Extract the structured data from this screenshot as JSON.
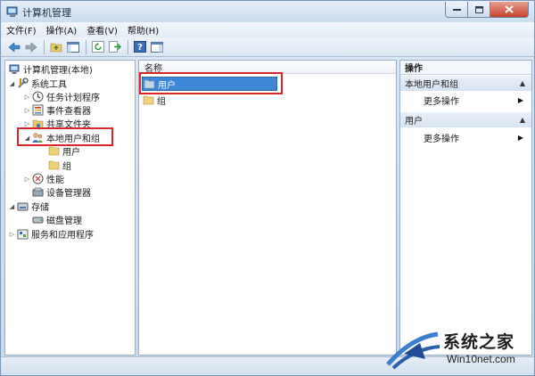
{
  "window": {
    "title": "计算机管理"
  },
  "menu": [
    "文件(F)",
    "操作(A)",
    "查看(V)",
    "帮助(H)"
  ],
  "tree": {
    "root": "计算机管理(本地)",
    "system_tools": "系统工具",
    "task_scheduler": "任务计划程序",
    "event_viewer": "事件查看器",
    "shared_folders": "共享文件夹",
    "local_users_groups": "本地用户和组",
    "users": "用户",
    "groups": "组",
    "performance": "性能",
    "device_manager": "设备管理器",
    "storage": "存储",
    "disk_management": "磁盘管理",
    "services_apps": "服务和应用程序"
  },
  "list": {
    "column_name": "名称",
    "items": [
      "用户",
      "组"
    ]
  },
  "actions": {
    "title": "操作",
    "group1": "本地用户和组",
    "more1": "更多操作",
    "group2": "用户",
    "more2": "更多操作"
  },
  "watermark": {
    "name": "系统之家",
    "url": "Win10net.com"
  },
  "colors": {
    "highlight_border": "#d9262b",
    "selection": "#3d86d8"
  }
}
